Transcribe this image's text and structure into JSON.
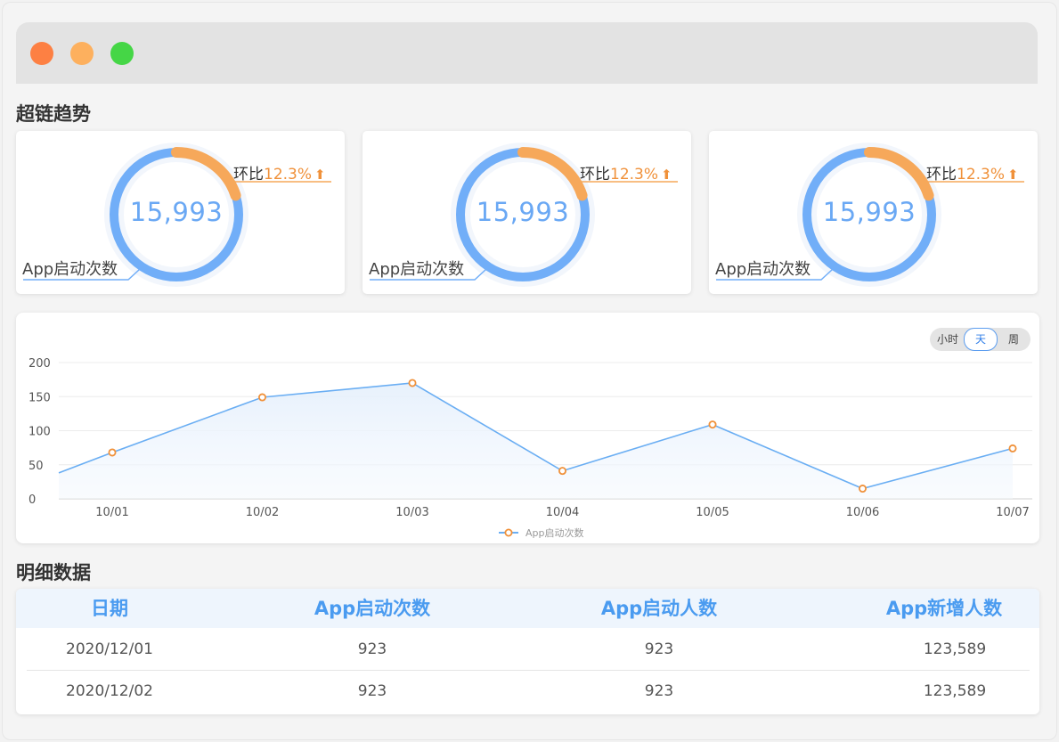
{
  "window": {
    "controls": [
      "close",
      "minimize",
      "maximize"
    ],
    "colors": {
      "close": "#fd8043",
      "minimize": "#fdb05e",
      "maximize": "#45d646"
    }
  },
  "trend_section": {
    "title": "超链趋势"
  },
  "kpi_cards": [
    {
      "value": "15,993",
      "label": "App启动次数",
      "ratio_label": "环比",
      "ratio_value": "12.3%",
      "direction": "up",
      "progress": 0.2
    },
    {
      "value": "15,993",
      "label": "App启动次数",
      "ratio_label": "环比",
      "ratio_value": "12.3%",
      "direction": "up",
      "progress": 0.2
    },
    {
      "value": "15,993",
      "label": "App启动次数",
      "ratio_label": "环比",
      "ratio_value": "12.3%",
      "direction": "up",
      "progress": 0.2
    }
  ],
  "time_toggle": {
    "options": [
      "小时",
      "天",
      "周"
    ],
    "selected": "天"
  },
  "chart_data": {
    "type": "area",
    "x": [
      "10/01",
      "10/02",
      "10/03",
      "10/04",
      "10/05",
      "10/06",
      "10/07"
    ],
    "series": [
      {
        "name": "App启动次数",
        "values": [
          68,
          149,
          170,
          41,
          109,
          15,
          74
        ]
      }
    ],
    "y_start_value": 38,
    "ylim": [
      0,
      200
    ],
    "yticks": [
      0,
      50,
      100,
      150,
      200
    ],
    "grid": true,
    "legend_position": "bottom-center",
    "colors": {
      "line": "#6aaef3",
      "marker": "#f0913a",
      "fill": "#e9f2fc"
    }
  },
  "detail_section": {
    "title": "明细数据"
  },
  "table": {
    "columns": [
      "日期",
      "App启动次数",
      "App启动人数",
      "App新增人数"
    ],
    "rows": [
      [
        "2020/12/01",
        "923",
        "923",
        "123,589"
      ],
      [
        "2020/12/02",
        "923",
        "923",
        "123,589"
      ]
    ]
  }
}
